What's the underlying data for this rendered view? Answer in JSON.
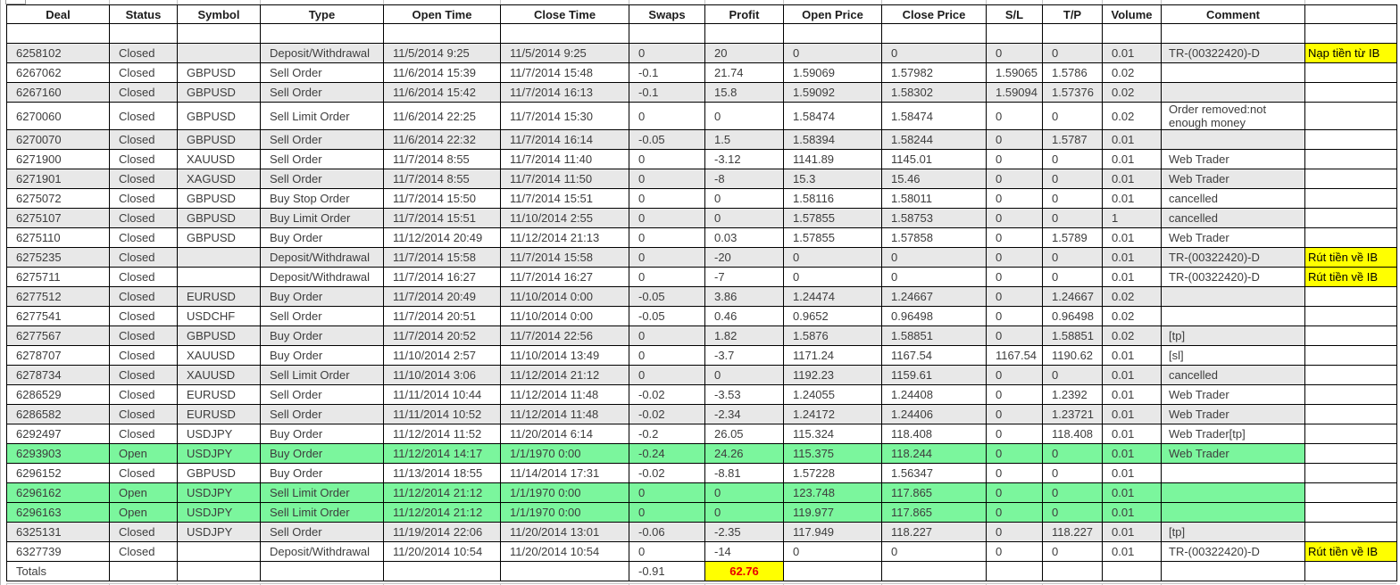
{
  "colors": {
    "open_row_green": "#7BF69D",
    "alt_row_gray": "#E8E8E8",
    "note_highlight_yellow": "#FFFF00",
    "totals_profit_red": "#E80000",
    "grid_border": "#000000"
  },
  "table": {
    "columns": [
      "Deal",
      "Status",
      "Symbol",
      "Type",
      "Open Time",
      "Close Time",
      "Swaps",
      "Profit",
      "Open Price",
      "Close Price",
      "S/L",
      "T/P",
      "Volume",
      "Comment",
      ""
    ],
    "fields": [
      "deal",
      "status",
      "symbol",
      "type",
      "open",
      "close",
      "swaps",
      "profit",
      "oprice",
      "cprice",
      "sl",
      "tp",
      "vol",
      "comment",
      "note"
    ],
    "rows": [
      {
        "bg": "w",
        "deal": "",
        "status": "",
        "symbol": "",
        "type": "",
        "open": "",
        "close": "",
        "swaps": "",
        "profit": "",
        "oprice": "",
        "cprice": "",
        "sl": "",
        "tp": "",
        "vol": "",
        "comment": "",
        "note": ""
      },
      {
        "bg": "a",
        "deal": "6258102",
        "status": "Closed",
        "symbol": "",
        "type": "Deposit/Withdrawal",
        "open": "11/5/2014 9:25",
        "close": "11/5/2014 9:25",
        "swaps": "0",
        "profit": "20",
        "oprice": "0",
        "cprice": "0",
        "sl": "0",
        "tp": "0",
        "vol": "0.01",
        "comment": "TR-(00322420)-D",
        "note": "Nạp tiền từ IB",
        "note_hl": true
      },
      {
        "bg": "w",
        "deal": "6267062",
        "status": "Closed",
        "symbol": "GBPUSD",
        "type": "Sell Order",
        "open": "11/6/2014 15:39",
        "close": "11/7/2014 15:48",
        "swaps": "-0.1",
        "profit": "21.74",
        "oprice": "1.59069",
        "cprice": "1.57982",
        "sl": "1.59065",
        "tp": "1.5786",
        "vol": "0.02",
        "comment": "",
        "note": ""
      },
      {
        "bg": "a",
        "deal": "6267160",
        "status": "Closed",
        "symbol": "GBPUSD",
        "type": "Sell Order",
        "open": "11/6/2014 15:42",
        "close": "11/7/2014 16:13",
        "swaps": "-0.1",
        "profit": "15.8",
        "oprice": "1.59092",
        "cprice": "1.58302",
        "sl": "1.59094",
        "tp": "1.57376",
        "vol": "0.02",
        "comment": "",
        "note": ""
      },
      {
        "bg": "w",
        "deal": "6270060",
        "status": "Closed",
        "symbol": "GBPUSD",
        "type": "Sell Limit Order",
        "open": "11/6/2014 22:25",
        "close": "11/7/2014 15:30",
        "swaps": "0",
        "profit": "0",
        "oprice": "1.58474",
        "cprice": "1.58474",
        "sl": "0",
        "tp": "0",
        "vol": "0.02",
        "comment": "Order removed:not enough money",
        "note": ""
      },
      {
        "bg": "a",
        "deal": "6270070",
        "status": "Closed",
        "symbol": "GBPUSD",
        "type": "Sell Order",
        "open": "11/6/2014 22:32",
        "close": "11/7/2014 16:14",
        "swaps": "-0.05",
        "profit": "1.5",
        "oprice": "1.58394",
        "cprice": "1.58244",
        "sl": "0",
        "tp": "1.5787",
        "vol": "0.01",
        "comment": "",
        "note": ""
      },
      {
        "bg": "w",
        "deal": "6271900",
        "status": "Closed",
        "symbol": "XAUUSD",
        "type": "Sell Order",
        "open": "11/7/2014 8:55",
        "close": "11/7/2014 11:40",
        "swaps": "0",
        "profit": "-3.12",
        "oprice": "1141.89",
        "cprice": "1145.01",
        "sl": "0",
        "tp": "0",
        "vol": "0.01",
        "comment": "Web Trader",
        "note": ""
      },
      {
        "bg": "a",
        "deal": "6271901",
        "status": "Closed",
        "symbol": "XAGUSD",
        "type": "Sell Order",
        "open": "11/7/2014 8:55",
        "close": "11/7/2014 11:50",
        "swaps": "0",
        "profit": "-8",
        "oprice": "15.3",
        "cprice": "15.46",
        "sl": "0",
        "tp": "0",
        "vol": "0.01",
        "comment": "Web Trader",
        "note": ""
      },
      {
        "bg": "w",
        "deal": "6275072",
        "status": "Closed",
        "symbol": "GBPUSD",
        "type": "Buy Stop Order",
        "open": "11/7/2014 15:50",
        "close": "11/7/2014 15:51",
        "swaps": "0",
        "profit": "0",
        "oprice": "1.58116",
        "cprice": "1.58011",
        "sl": "0",
        "tp": "0",
        "vol": "0.01",
        "comment": "cancelled",
        "note": ""
      },
      {
        "bg": "a",
        "deal": "6275107",
        "status": "Closed",
        "symbol": "GBPUSD",
        "type": "Buy Limit Order",
        "open": "11/7/2014 15:51",
        "close": "11/10/2014 2:55",
        "swaps": "0",
        "profit": "0",
        "oprice": "1.57855",
        "cprice": "1.58753",
        "sl": "0",
        "tp": "0",
        "vol": "1",
        "comment": "cancelled",
        "note": ""
      },
      {
        "bg": "w",
        "deal": "6275110",
        "status": "Closed",
        "symbol": "GBPUSD",
        "type": "Buy Order",
        "open": "11/12/2014 20:49",
        "close": "11/12/2014 21:13",
        "swaps": "0",
        "profit": "0.03",
        "oprice": "1.57855",
        "cprice": "1.57858",
        "sl": "0",
        "tp": "1.5789",
        "vol": "0.01",
        "comment": "Web Trader",
        "note": ""
      },
      {
        "bg": "a",
        "deal": "6275235",
        "status": "Closed",
        "symbol": "",
        "type": "Deposit/Withdrawal",
        "open": "11/7/2014 15:58",
        "close": "11/7/2014 15:58",
        "swaps": "0",
        "profit": "-20",
        "oprice": "0",
        "cprice": "0",
        "sl": "0",
        "tp": "0",
        "vol": "0.01",
        "comment": "TR-(00322420)-D",
        "note": "Rút tiền về IB",
        "note_hl": true
      },
      {
        "bg": "w",
        "deal": "6275711",
        "status": "Closed",
        "symbol": "",
        "type": "Deposit/Withdrawal",
        "open": "11/7/2014 16:27",
        "close": "11/7/2014 16:27",
        "swaps": "0",
        "profit": "-7",
        "oprice": "0",
        "cprice": "0",
        "sl": "0",
        "tp": "0",
        "vol": "0.01",
        "comment": "TR-(00322420)-D",
        "note": "Rút tiền về IB",
        "note_hl": true
      },
      {
        "bg": "a",
        "deal": "6277512",
        "status": "Closed",
        "symbol": "EURUSD",
        "type": "Buy Order",
        "open": "11/7/2014 20:49",
        "close": "11/10/2014 0:00",
        "swaps": "-0.05",
        "profit": "3.86",
        "oprice": "1.24474",
        "cprice": "1.24667",
        "sl": "0",
        "tp": "1.24667",
        "vol": "0.02",
        "comment": "",
        "note": ""
      },
      {
        "bg": "w",
        "deal": "6277541",
        "status": "Closed",
        "symbol": "USDCHF",
        "type": "Sell Order",
        "open": "11/7/2014 20:51",
        "close": "11/10/2014 0:00",
        "swaps": "-0.05",
        "profit": "0.46",
        "oprice": "0.9652",
        "cprice": "0.96498",
        "sl": "0",
        "tp": "0.96498",
        "vol": "0.02",
        "comment": "",
        "note": ""
      },
      {
        "bg": "a",
        "deal": "6277567",
        "status": "Closed",
        "symbol": "GBPUSD",
        "type": "Buy Order",
        "open": "11/7/2014 20:52",
        "close": "11/7/2014 22:56",
        "swaps": "0",
        "profit": "1.82",
        "oprice": "1.5876",
        "cprice": "1.58851",
        "sl": "0",
        "tp": "1.58851",
        "vol": "0.02",
        "comment": "[tp]",
        "note": ""
      },
      {
        "bg": "w",
        "deal": "6278707",
        "status": "Closed",
        "symbol": "XAUUSD",
        "type": "Buy Order",
        "open": "11/10/2014 2:57",
        "close": "11/10/2014 13:49",
        "swaps": "0",
        "profit": "-3.7",
        "oprice": "1171.24",
        "cprice": "1167.54",
        "sl": "1167.54",
        "tp": "1190.62",
        "vol": "0.01",
        "comment": "[sl]",
        "note": ""
      },
      {
        "bg": "a",
        "deal": "6278734",
        "status": "Closed",
        "symbol": "XAUUSD",
        "type": "Sell Limit Order",
        "open": "11/10/2014 3:06",
        "close": "11/12/2014 21:12",
        "swaps": "0",
        "profit": "0",
        "oprice": "1192.23",
        "cprice": "1159.61",
        "sl": "0",
        "tp": "0",
        "vol": "0.01",
        "comment": "cancelled",
        "note": ""
      },
      {
        "bg": "w",
        "deal": "6286529",
        "status": "Closed",
        "symbol": "EURUSD",
        "type": "Sell Order",
        "open": "11/11/2014 10:44",
        "close": "11/12/2014 11:48",
        "swaps": "-0.02",
        "profit": "-3.53",
        "oprice": "1.24055",
        "cprice": "1.24408",
        "sl": "0",
        "tp": "1.2392",
        "vol": "0.01",
        "comment": "Web Trader",
        "note": ""
      },
      {
        "bg": "a",
        "deal": "6286582",
        "status": "Closed",
        "symbol": "EURUSD",
        "type": "Sell Order",
        "open": "11/11/2014 10:52",
        "close": "11/12/2014 11:48",
        "swaps": "-0.02",
        "profit": "-2.34",
        "oprice": "1.24172",
        "cprice": "1.24406",
        "sl": "0",
        "tp": "1.23721",
        "vol": "0.01",
        "comment": "Web Trader",
        "note": ""
      },
      {
        "bg": "w",
        "deal": "6292497",
        "status": "Closed",
        "symbol": "USDJPY",
        "type": "Buy Order",
        "open": "11/12/2014 11:52",
        "close": "11/20/2014 6:14",
        "swaps": "-0.2",
        "profit": "26.05",
        "oprice": "115.324",
        "cprice": "118.408",
        "sl": "0",
        "tp": "118.408",
        "vol": "0.01",
        "comment": "Web Trader[tp]",
        "note": ""
      },
      {
        "bg": "g",
        "deal": "6293903",
        "status": "Open",
        "symbol": "USDJPY",
        "type": "Buy Order",
        "open": "11/12/2014 14:17",
        "close": "1/1/1970 0:00",
        "swaps": "-0.24",
        "profit": "24.26",
        "oprice": "115.375",
        "cprice": "118.244",
        "sl": "0",
        "tp": "0",
        "vol": "0.01",
        "comment": "Web Trader",
        "note": ""
      },
      {
        "bg": "w",
        "deal": "6296152",
        "status": "Closed",
        "symbol": "GBPUSD",
        "type": "Buy Order",
        "open": "11/13/2014 18:55",
        "close": "11/14/2014 17:31",
        "swaps": "-0.02",
        "profit": "-8.81",
        "oprice": "1.57228",
        "cprice": "1.56347",
        "sl": "0",
        "tp": "0",
        "vol": "0.01",
        "comment": "",
        "note": ""
      },
      {
        "bg": "g",
        "deal": "6296162",
        "status": "Open",
        "symbol": "USDJPY",
        "type": "Sell Limit Order",
        "open": "11/12/2014 21:12",
        "close": "1/1/1970 0:00",
        "swaps": "0",
        "profit": "0",
        "oprice": "123.748",
        "cprice": "117.865",
        "sl": "0",
        "tp": "0",
        "vol": "0.01",
        "comment": "",
        "note": ""
      },
      {
        "bg": "g",
        "deal": "6296163",
        "status": "Open",
        "symbol": "USDJPY",
        "type": "Sell Limit Order",
        "open": "11/12/2014 21:12",
        "close": "1/1/1970 0:00",
        "swaps": "0",
        "profit": "0",
        "oprice": "119.977",
        "cprice": "117.865",
        "sl": "0",
        "tp": "0",
        "vol": "0.01",
        "comment": "",
        "note": ""
      },
      {
        "bg": "a",
        "deal": "6325131",
        "status": "Closed",
        "symbol": "USDJPY",
        "type": "Sell Order",
        "open": "11/19/2014 22:06",
        "close": "11/20/2014 13:01",
        "swaps": "-0.06",
        "profit": "-2.35",
        "oprice": "117.949",
        "cprice": "118.227",
        "sl": "0",
        "tp": "118.227",
        "vol": "0.01",
        "comment": "[tp]",
        "note": ""
      },
      {
        "bg": "w",
        "deal": "6327739",
        "status": "Closed",
        "symbol": "",
        "type": "Deposit/Withdrawal",
        "open": "11/20/2014 10:54",
        "close": "11/20/2014 10:54",
        "swaps": "0",
        "profit": "-14",
        "oprice": "0",
        "cprice": "0",
        "sl": "0",
        "tp": "0",
        "vol": "0.01",
        "comment": "TR-(00322420)-D",
        "note": "Rút tiền về IB",
        "note_hl": true
      }
    ],
    "totals": {
      "label": "Totals",
      "swaps": "-0.91",
      "profit": "62.76"
    }
  }
}
